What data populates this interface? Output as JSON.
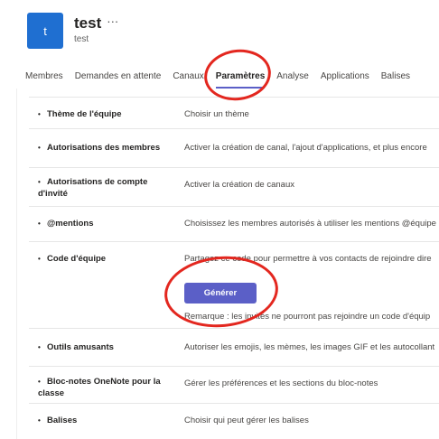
{
  "team": {
    "avatar_letter": "t",
    "name": "test",
    "more_icon": "more-icon",
    "subtitle": "test"
  },
  "tabs": [
    {
      "label": "Membres",
      "active": false
    },
    {
      "label": "Demandes en attente",
      "active": false
    },
    {
      "label": "Canaux",
      "active": false
    },
    {
      "label": "Paramètres",
      "active": true
    },
    {
      "label": "Analyse",
      "active": false
    },
    {
      "label": "Applications",
      "active": false
    },
    {
      "label": "Balises",
      "active": false
    }
  ],
  "settings": [
    {
      "title": "Thème de l'équipe",
      "desc": "Choisir un thème"
    },
    {
      "title": "Autorisations des membres",
      "desc": "Activer la création de canal, l'ajout d'applications, et plus encore"
    },
    {
      "title": "Autorisations de compte d'invité",
      "desc": "Activer la création de canaux"
    },
    {
      "title": "@mentions",
      "desc": "Choisissez les membres autorisés à utiliser les mentions @équipe"
    },
    {
      "title": "Code d'équipe",
      "desc": "Partagez ce code pour permettre à vos contacts de rejoindre dire",
      "button": "Générer",
      "note": "Remarque : les invités ne pourront pas rejoindre un code d'équip"
    },
    {
      "title": "Outils amusants",
      "desc": "Autoriser les emojis, les mèmes, les images GIF et les autocollant"
    },
    {
      "title": "Bloc-notes OneNote pour la classe",
      "desc": "Gérer les préférences et les sections du bloc-notes"
    },
    {
      "title": "Balises",
      "desc": "Choisir qui peut gérer les balises"
    }
  ],
  "colors": {
    "accent": "#5b5fc7",
    "avatar": "#1f6fd1",
    "annotation": "#e3271f"
  }
}
